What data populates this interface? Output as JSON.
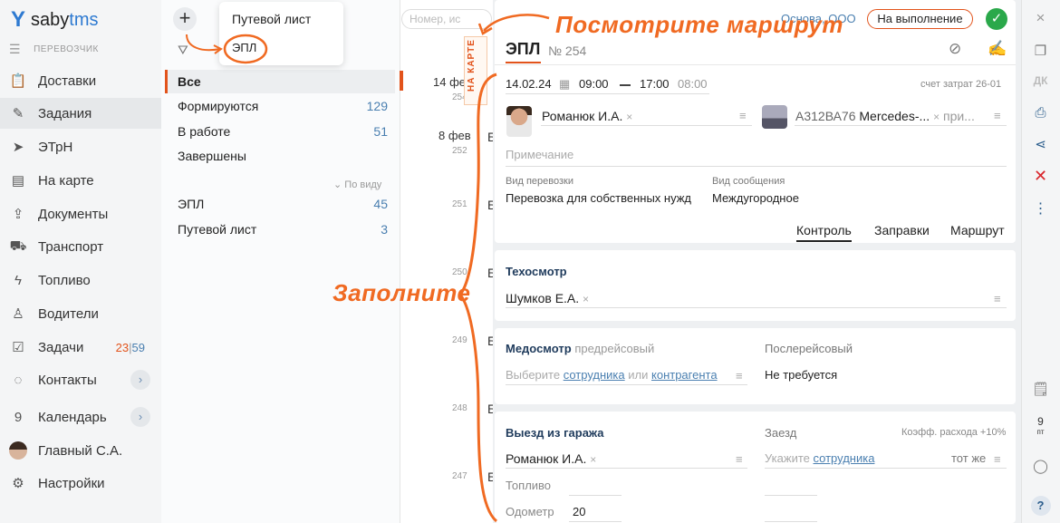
{
  "app": {
    "logo_prefix": "saby",
    "logo_suffix": "tms",
    "role": "ПЕРЕВОЗЧИК"
  },
  "nav": [
    {
      "label": "Доставки",
      "icon": "clipboard-icon"
    },
    {
      "label": "Задания",
      "icon": "edit-icon",
      "active": true
    },
    {
      "label": "ЭТрН",
      "icon": "send-icon"
    },
    {
      "label": "На карте",
      "icon": "map-icon"
    },
    {
      "label": "Документы",
      "icon": "upload-icon"
    },
    {
      "label": "Транспорт",
      "icon": "truck-icon"
    },
    {
      "label": "Топливо",
      "icon": "flash-icon"
    },
    {
      "label": "Водители",
      "icon": "people-icon"
    },
    {
      "label": "Задачи",
      "icon": "task-icon",
      "count_red": "23",
      "count_blue": "59"
    },
    {
      "label": "Контакты",
      "icon": "chat-icon"
    },
    {
      "label": "Календарь",
      "icon_text": "9"
    },
    {
      "label": "Главный С.А."
    },
    {
      "label": "Настройки",
      "icon": "gear-icon"
    }
  ],
  "popup": {
    "option1": "Путевой лист",
    "option2": "ЭПЛ"
  },
  "folders": [
    {
      "label": "Все",
      "count": ""
    },
    {
      "label": "Формируются",
      "count": "129"
    },
    {
      "label": "В работе",
      "count": "51"
    },
    {
      "label": "Завершены",
      "count": ""
    }
  ],
  "by_view": "По виду",
  "doc_types": [
    {
      "label": "ЭПЛ",
      "count": "45"
    },
    {
      "label": "Путевой лист",
      "count": "3"
    }
  ],
  "list": {
    "search_placeholder": "Номер, ис",
    "items": [
      {
        "date": "14 фев",
        "num": "254"
      },
      {
        "date": "8 фев",
        "num": "252",
        "letter": "Б"
      },
      {
        "num": "251",
        "letter": "Б"
      },
      {
        "num": "250",
        "letter": "Б"
      },
      {
        "num": "249",
        "letter": "Б"
      },
      {
        "num": "248",
        "letter": "Б"
      },
      {
        "num": "247",
        "letter": "Б"
      }
    ]
  },
  "card": {
    "org": "Основа, ООО",
    "status": "На выполнение",
    "title": "ЭПЛ",
    "doc_no": "№ 254",
    "date": "14.02.24",
    "time_from": "09:00",
    "time_to": "17:00",
    "time_extra": "08:00",
    "cost_account": "счет затрат 26-01",
    "driver": "Романюк И.А.",
    "vehicle_plate": "А312ВА76",
    "vehicle_model": "Mercedes-...",
    "vehicle_extra": "при...",
    "note_placeholder": "Примечание",
    "transport_type_label": "Вид перевозки",
    "transport_type": "Перевозка для собственных нужд",
    "route_type_label": "Вид сообщения",
    "route_type": "Междугородное",
    "tabs": [
      "Контроль",
      "Заправки",
      "Маршрут"
    ],
    "tech": {
      "title": "Техосмотр",
      "person": "Шумков Е.А."
    },
    "med": {
      "title": "Медосмотр",
      "pre": "предрейсовый",
      "post": "Послерейсовый",
      "choose_prefix": "Выберите",
      "choose_employee": "сотрудника",
      "choose_or": "или",
      "choose_contractor": "контрагента",
      "post_value": "Не требуется"
    },
    "garage": {
      "title": "Выезд из гаража",
      "return": "Заезд",
      "coef": "Коэфф. расхода +10%",
      "driver": "Романюк И.А.",
      "specify_prefix": "Укажите",
      "specify_employee": "сотрудника",
      "same": "тот же",
      "fuel_label": "Топливо",
      "odo_label": "Одометр",
      "odo_value": "20"
    }
  },
  "rail": {
    "dk": "ДК",
    "day_num": "9",
    "day_name": "пт",
    "help": "?"
  },
  "annotations": {
    "see_route": "Посмотрите маршрут",
    "on_map": "НА КАРТЕ",
    "fill": "Заполните"
  },
  "colors": {
    "accent": "#e2531b",
    "annotation": "#f06a22",
    "link": "#4a7fb0",
    "ok": "#2aa84a"
  }
}
